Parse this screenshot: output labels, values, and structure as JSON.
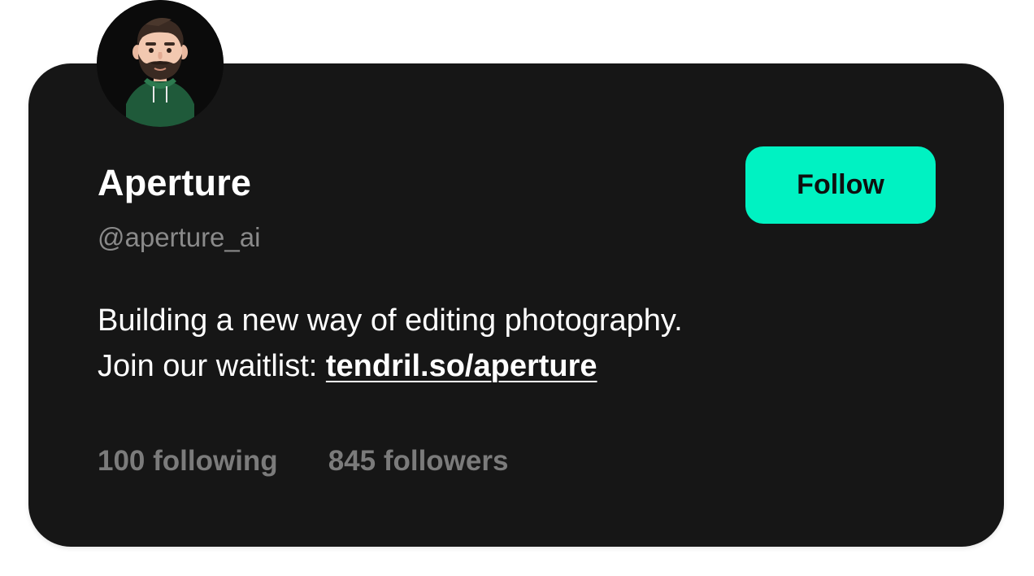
{
  "profile": {
    "name": "Aperture",
    "handle": "@aperture_ai",
    "bio_line1": "Building a new way of editing photography.",
    "bio_line2_prefix": "Join our waitlist: ",
    "bio_link": "tendril.so/aperture",
    "avatar_icon": "bearded-man-hoodie-avatar"
  },
  "actions": {
    "follow_label": "Follow"
  },
  "stats": {
    "following": "100 following",
    "followers": "845 followers"
  },
  "colors": {
    "card_background": "#161616",
    "accent": "#00f2c2",
    "muted_text": "#7b7b7b"
  }
}
